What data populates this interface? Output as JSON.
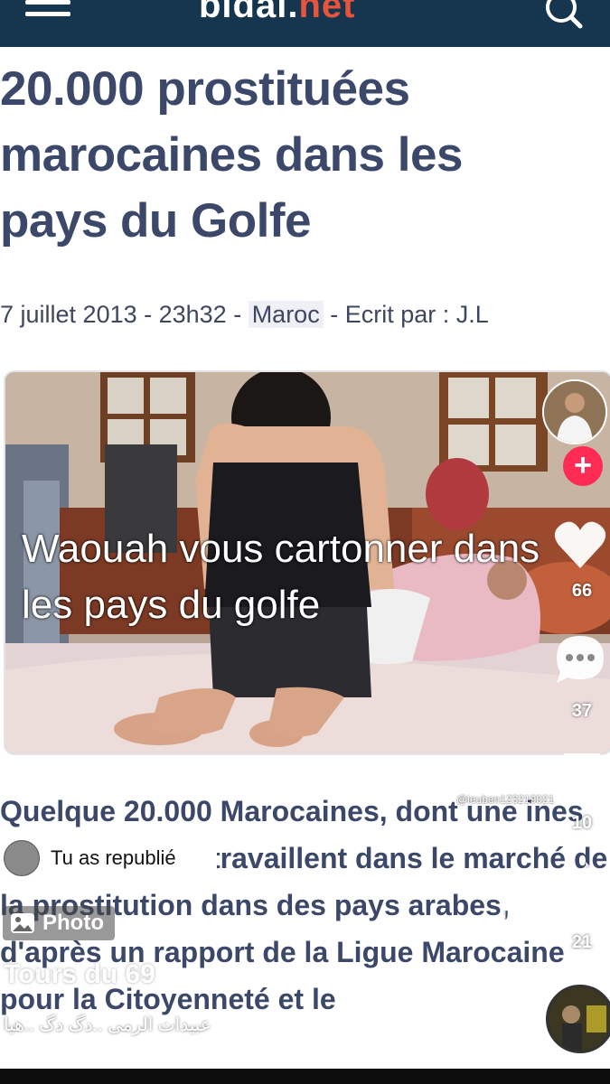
{
  "site": {
    "logo_main": "bldal.",
    "logo_tld": "net"
  },
  "article": {
    "headline": "20.000 prostituées marocaines dans les pays du Golfe",
    "meta_date": "7 juillet 2013 - 23h32 - ",
    "meta_category": "Maroc",
    "meta_author": " - Ecrit par : J.L",
    "body": "Quelque 20.000 Marocaines, dont une     ines filles mineures travaillent dans le marché de la prostitution dans des pays arabes, d'après un rapport de la Ligue Marocaine pour la Citoyenneté et le"
  },
  "overlay": {
    "caption": "Waouah vous cartonner dans les pays du golfe"
  },
  "tiktok": {
    "like_count": "66",
    "comment_count": "37",
    "save_count": "10",
    "share_count": "21",
    "handle": "@ieuben123219021"
  },
  "repost": {
    "label": "Tu as republié"
  },
  "photo_badge": {
    "label": "Photo"
  },
  "username": "Tours du 69",
  "caption_ar": "عبيدات الرمى ..دگ دگ ..هيا",
  "colors": {
    "topbar": "#16354e",
    "headline": "#3c4869",
    "like": "#ffffff",
    "follow": "#fe2c55"
  }
}
